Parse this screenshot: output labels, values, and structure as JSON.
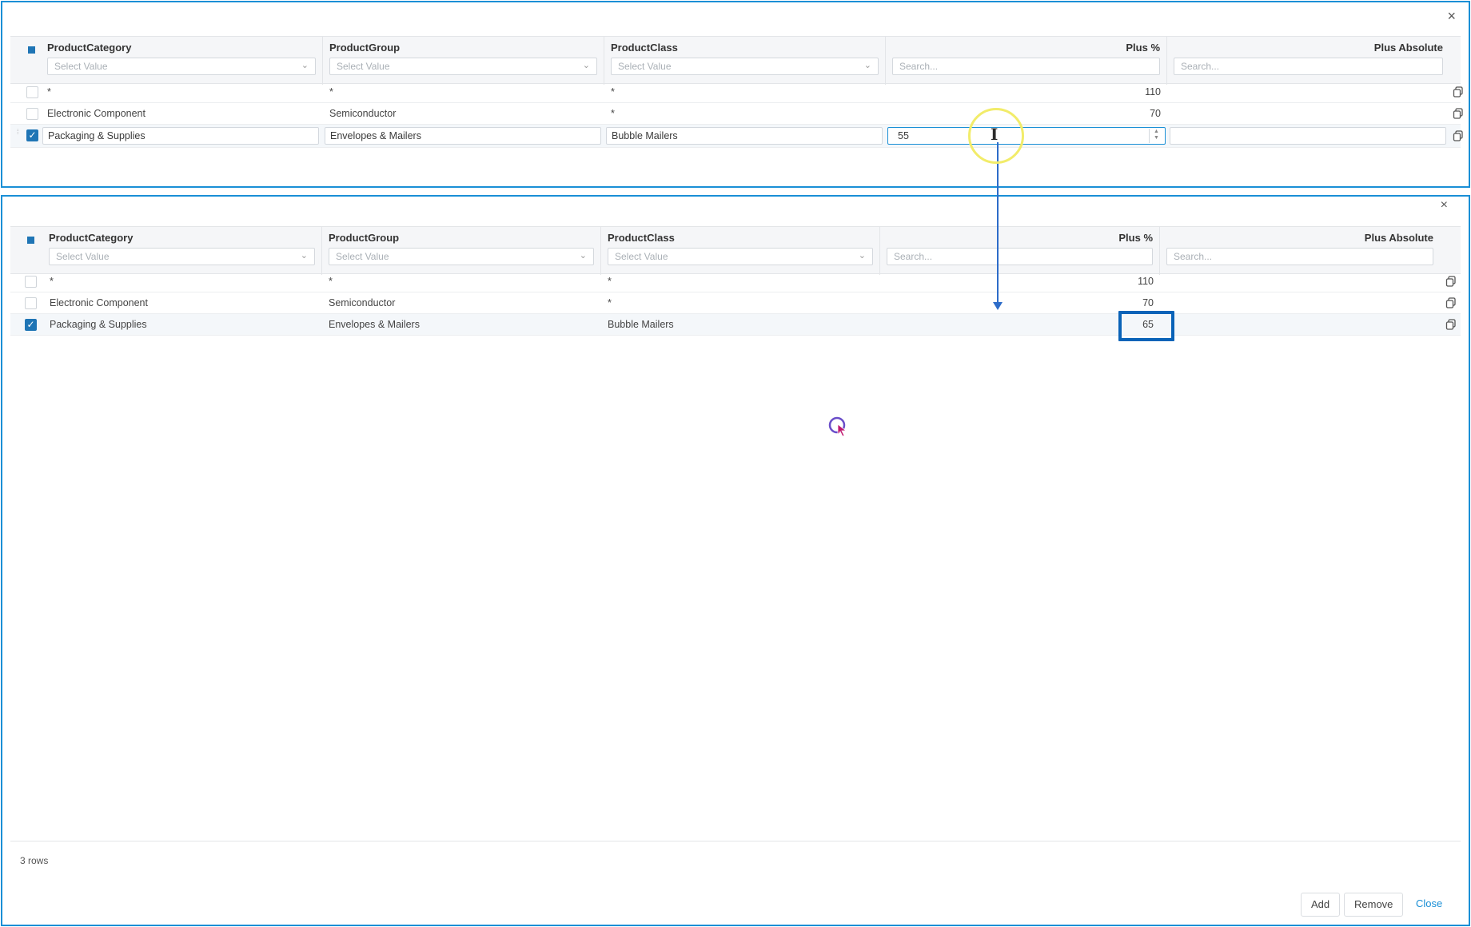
{
  "top_panel": {
    "close_glyph": "×",
    "columns": {
      "product_category": "ProductCategory",
      "product_group": "ProductGroup",
      "product_class": "ProductClass",
      "plus_percent": "Plus %",
      "plus_absolute": "Plus Absolute"
    },
    "filters": {
      "select_placeholder": "Select Value",
      "search_placeholder": "Search..."
    },
    "rows": [
      {
        "category": "*",
        "group": "*",
        "class": "*",
        "plus_percent": "110",
        "plus_absolute": "",
        "checked": false
      },
      {
        "category": "Electronic Component",
        "group": "Semiconductor",
        "class": "*",
        "plus_percent": "70",
        "plus_absolute": "",
        "checked": false
      },
      {
        "category": "Packaging & Supplies",
        "group": "Envelopes & Mailers",
        "class": "Bubble Mailers",
        "plus_percent": "55",
        "plus_absolute": "",
        "checked": true
      }
    ]
  },
  "bottom_panel": {
    "close_glyph": "×",
    "columns": {
      "product_category": "ProductCategory",
      "product_group": "ProductGroup",
      "product_class": "ProductClass",
      "plus_percent": "Plus %",
      "plus_absolute": "Plus Absolute"
    },
    "filters": {
      "select_placeholder": "Select Value",
      "search_placeholder": "Search..."
    },
    "rows": [
      {
        "category": "*",
        "group": "*",
        "class": "*",
        "plus_percent": "110",
        "plus_absolute": "",
        "checked": false
      },
      {
        "category": "Electronic Component",
        "group": "Semiconductor",
        "class": "*",
        "plus_percent": "70",
        "plus_absolute": "",
        "checked": false
      },
      {
        "category": "Packaging & Supplies",
        "group": "Envelopes & Mailers",
        "class": "Bubble Mailers",
        "plus_percent": "65",
        "plus_absolute": "",
        "checked": true
      }
    ],
    "footer": {
      "row_count": "3 rows",
      "add_label": "Add",
      "remove_label": "Remove",
      "close_label": "Close"
    }
  },
  "icons": {
    "chevron": "⌄",
    "check": "✓",
    "ibeam": "I"
  },
  "colors": {
    "panel_border": "#1a8fd6",
    "accent": "#1f75b5",
    "highlight": "#0a63b8",
    "cursor_ring": "#f2ec6a"
  }
}
